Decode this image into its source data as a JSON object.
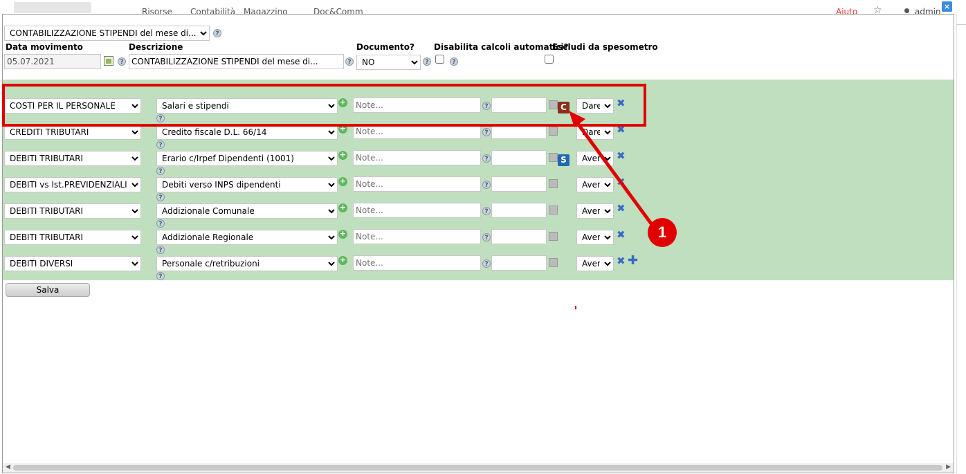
{
  "nav": {
    "items": [
      "Risorse",
      "Contabilità",
      "Magazzino",
      "Doc&Comm"
    ],
    "help": "Aiuto",
    "user": "admin",
    "close": "×"
  },
  "form": {
    "causale": "CONTABILIZZAZIONE STIPENDI del mese di...",
    "date_label": "Data movimento",
    "date_value": "05.07.2021",
    "desc_label": "Descrizione",
    "desc_value": "CONTABILIZZAZIONE STIPENDI del mese di...",
    "doc_label": "Documento?",
    "doc_value": "NO",
    "disable_label": "Disabilita calcoli automatici?",
    "exclude_label": "Escludi da spesometro"
  },
  "rows": [
    {
      "account": "COSTI PER IL PERSONALE",
      "subaccount": "Salari e stipendi",
      "notes_placeholder": "Note...",
      "side": "Dare",
      "badge": "C"
    },
    {
      "account": "CREDITI TRIBUTARI",
      "subaccount": "Credito fiscale D.L. 66/14",
      "notes_placeholder": "Note...",
      "side": "Dare",
      "badge": ""
    },
    {
      "account": "DEBITI TRIBUTARI",
      "subaccount": "Erario c/Irpef Dipendenti (1001)",
      "notes_placeholder": "Note...",
      "side": "Avere",
      "badge": "S"
    },
    {
      "account": "DEBITI vs Ist.PREVIDENZIALI",
      "subaccount": "Debiti verso INPS dipendenti",
      "notes_placeholder": "Note...",
      "side": "Avere",
      "badge": ""
    },
    {
      "account": "DEBITI TRIBUTARI",
      "subaccount": "Addizionale Comunale",
      "notes_placeholder": "Note...",
      "side": "Avere",
      "badge": ""
    },
    {
      "account": "DEBITI TRIBUTARI",
      "subaccount": "Addizionale Regionale",
      "notes_placeholder": "Note...",
      "side": "Avere",
      "badge": ""
    },
    {
      "account": "DEBITI DIVERSI",
      "subaccount": "Personale c/retribuzioni",
      "notes_placeholder": "Note...",
      "side": "Avere",
      "badge": ""
    }
  ],
  "actions": {
    "save": "Salva"
  },
  "annotation": {
    "number": "1"
  },
  "icons": [
    "help-icon",
    "calendar-icon",
    "add-subaccount-icon",
    "calculator-icon",
    "delete-row-icon",
    "add-row-icon"
  ],
  "colors": {
    "rows_background": "#c0dfbe",
    "highlight": "#e00000",
    "badge_c": "#8e2d1a",
    "badge_s": "#1e6ab0"
  }
}
